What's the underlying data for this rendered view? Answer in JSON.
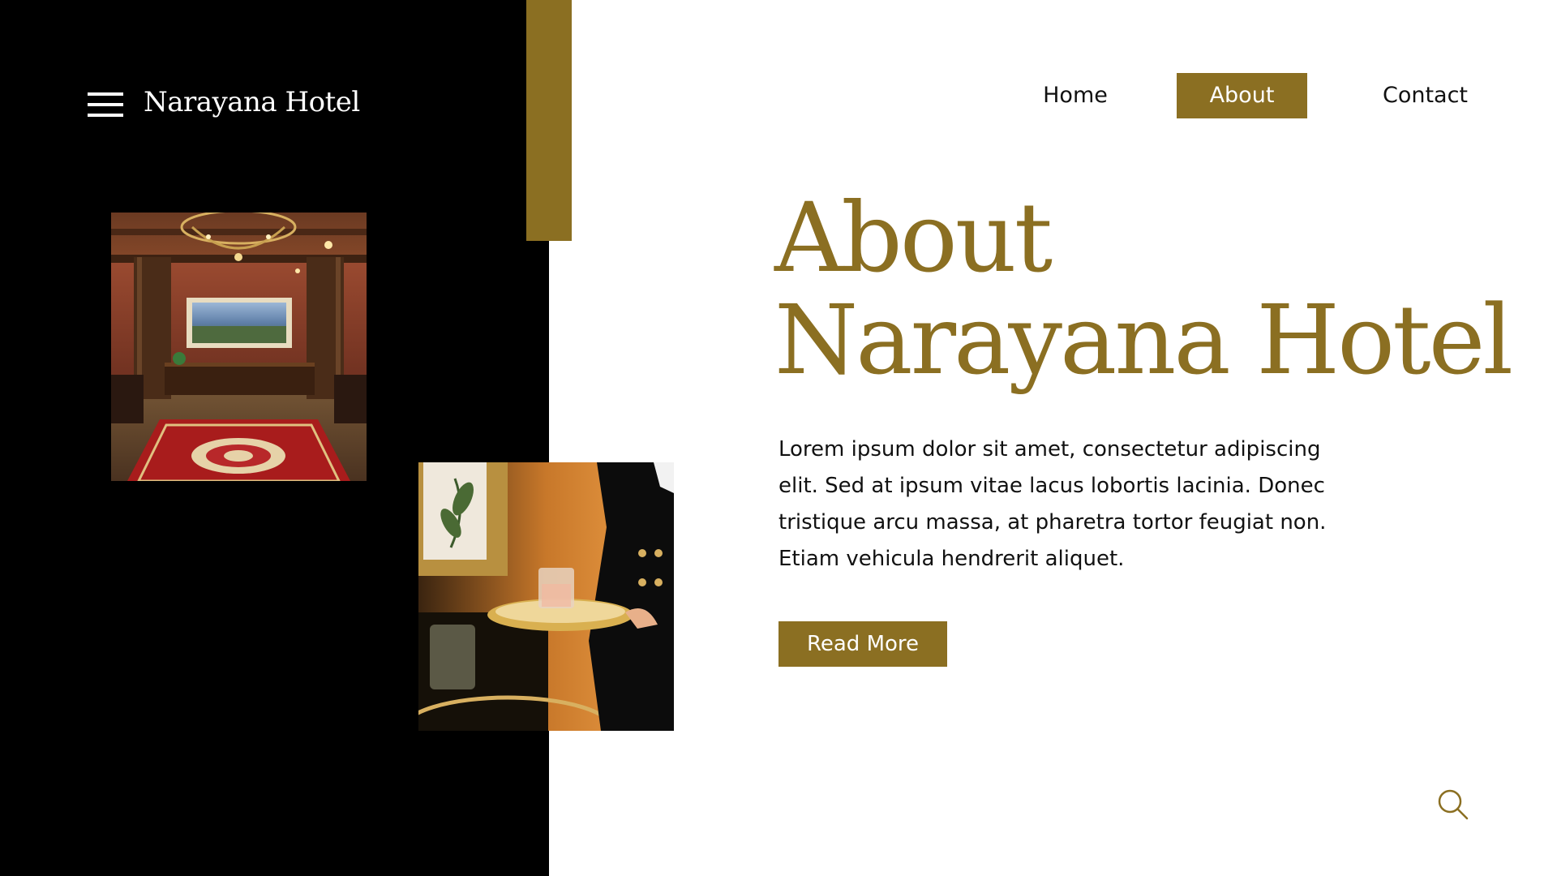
{
  "brand": {
    "name": "Narayana Hotel"
  },
  "nav": {
    "items": [
      {
        "label": "Home",
        "active": false
      },
      {
        "label": "About",
        "active": true
      },
      {
        "label": "Contact",
        "active": false
      }
    ]
  },
  "hero": {
    "title_line1": "About",
    "title_line2": "Narayana Hotel",
    "body": "Lorem ipsum dolor sit amet, consectetur adipiscing elit. Sed at ipsum vitae lacus lobortis lacinia. Donec tristique arcu massa, at pharetra tortor feugiat non. Etiam vehicula hendrerit aliquet.",
    "cta_label": "Read More"
  },
  "colors": {
    "accent": "#8B6F22",
    "dark_panel": "#000000",
    "background": "#FFFFFF",
    "text": "#111111"
  },
  "icons": {
    "menu": "hamburger-menu-icon",
    "search": "search-icon"
  }
}
